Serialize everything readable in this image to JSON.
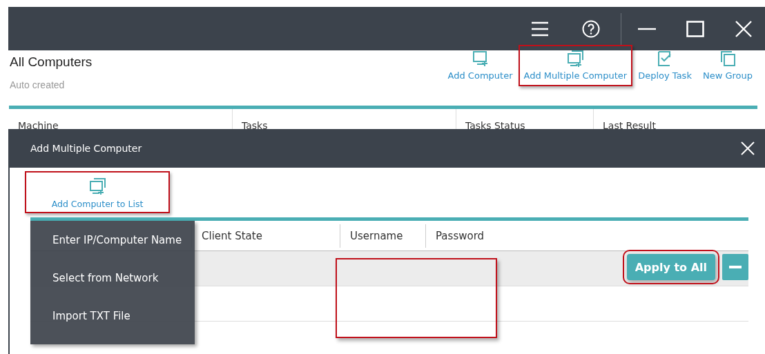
{
  "window": {
    "controls": [
      {
        "kind": "menu"
      },
      {
        "kind": "help"
      },
      {
        "kind": "minimize"
      },
      {
        "kind": "maximize"
      },
      {
        "kind": "close"
      }
    ]
  },
  "page": {
    "title": "All Computers",
    "subtitle": "Auto created"
  },
  "toolbar": [
    {
      "label": "Add Computer",
      "kind": "add",
      "highlighted": false
    },
    {
      "label": "Add Multiple Computer",
      "kind": "multi",
      "highlighted": true
    },
    {
      "label": "Deploy Task",
      "kind": "task",
      "highlighted": false
    },
    {
      "label": "New Group",
      "kind": "group",
      "highlighted": false
    }
  ],
  "table": {
    "columns": [
      "Machine",
      "Tasks",
      "Tasks Status",
      "Last Result"
    ]
  },
  "dialog": {
    "title": "Add Multiple Computer",
    "add_button": {
      "label": "Add Computer to List",
      "highlighted": true
    },
    "menu": {
      "items": [
        "Enter IP/Computer Name",
        "Select from Network",
        "Import TXT File"
      ]
    },
    "columns": [
      "Client State",
      "Username",
      "Password"
    ],
    "rows": [
      {
        "selected": true
      },
      {
        "selected": false
      }
    ],
    "apply_button": {
      "label": "Apply to All",
      "highlighted": true
    },
    "annotation_boxes": [
      {
        "kind": "rectangle"
      }
    ]
  }
}
